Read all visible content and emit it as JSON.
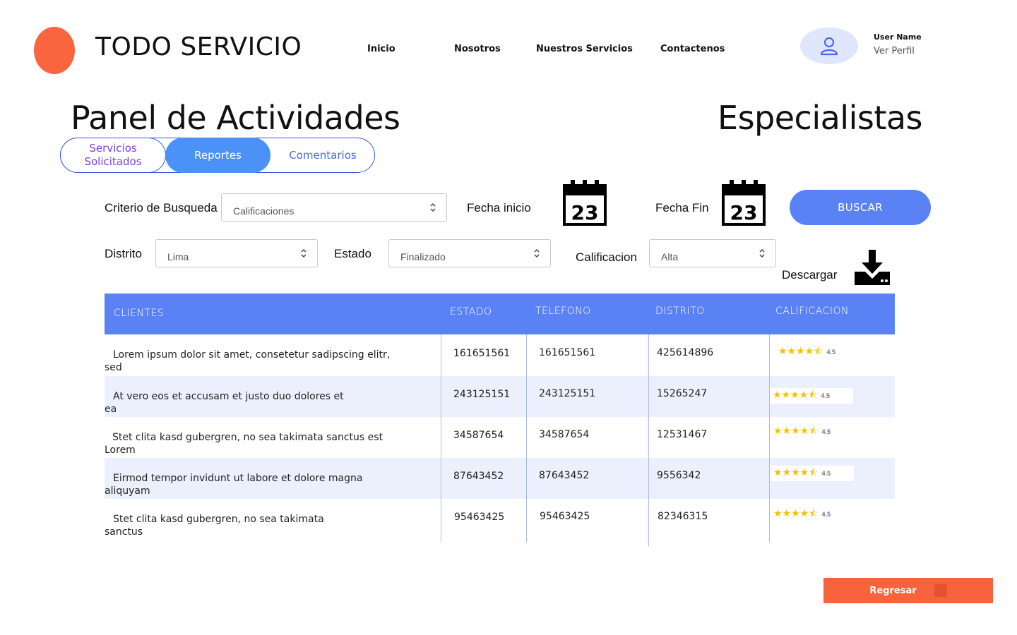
{
  "header": {
    "brand": "TODO SERVICIO",
    "nav": [
      "Inicio",
      "Nosotros",
      "Nuestros Servicios",
      "Contactenos"
    ],
    "user_name": "User Name",
    "profile_link": "Ver Perfil"
  },
  "panel_title": "Panel de Actividades",
  "specialists_title": "Especialistas",
  "tabs": [
    {
      "label": "Servicios Solicitados",
      "active": false
    },
    {
      "label": "Reportes",
      "active": true
    },
    {
      "label": "Comentarios",
      "active": false
    }
  ],
  "filters": {
    "criterio_label": "Criterio de Busqueda",
    "criterio_value": "Calificaciones",
    "fecha_inicio_label": "Fecha inicio",
    "fecha_fin_label": "Fecha Fin",
    "calendar_day": "23",
    "buscar_label": "BUSCAR",
    "distrito_label": "Distrito",
    "distrito_value": "Lima",
    "estado_label": "Estado",
    "estado_value": "Finalizado",
    "calificacion_label": "Calificacion",
    "calificacion_value": "Alta",
    "descargar_label": "Descargar"
  },
  "table": {
    "headers": [
      "CLIENTES",
      "ESTADO",
      "TELEFONO",
      "DISTRITO",
      "CALIFICACION"
    ],
    "rows": [
      {
        "cliente_l1": "Lorem ipsum dolor sit amet, consetetur sadipscing elitr,",
        "cliente_l2": "sed",
        "estado": "161651561",
        "telefono": "161651561",
        "distrito": "425614896",
        "rating": "4.5"
      },
      {
        "cliente_l1": "At vero eos et accusam et justo duo dolores et",
        "cliente_l2": "ea",
        "estado": "243125151",
        "telefono": "243125151",
        "distrito": "15265247",
        "rating": "4.5"
      },
      {
        "cliente_l1": "Stet clita kasd gubergren, no sea takimata sanctus est",
        "cliente_l2": "Lorem",
        "estado": "34587654",
        "telefono": "34587654",
        "distrito": "12531467",
        "rating": "4.5"
      },
      {
        "cliente_l1": "Eirmod tempor invidunt ut labore et dolore magna",
        "cliente_l2": "aliquyam",
        "estado": "87643452",
        "telefono": "87643452",
        "distrito": "9556342",
        "rating": "4.5"
      },
      {
        "cliente_l1": "Stet clita kasd gubergren, no sea takimata",
        "cliente_l2": "sanctus",
        "estado": "95463425",
        "telefono": "95463425",
        "distrito": "82346315",
        "rating": "4.5"
      }
    ]
  },
  "stars_glyph": "★★★★⯪",
  "regresar_label": "Regresar",
  "colors": {
    "accent_orange": "#f9653f",
    "accent_blue": "#5a82f5",
    "tab_active": "#4b91f7",
    "star": "#f6c000"
  }
}
